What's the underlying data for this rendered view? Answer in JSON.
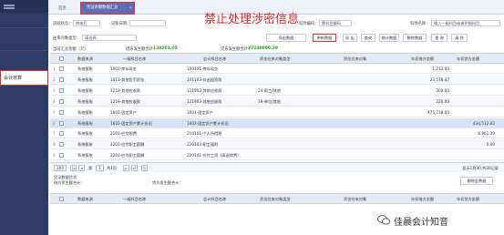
{
  "tabs": [
    {
      "label": "首页"
    },
    {
      "label": "凭证余额数据汇总"
    }
  ],
  "watermark_text": "禁止处理涉密信息",
  "sidebar": {
    "active_item": "会计核算"
  },
  "filters": {
    "row1": [
      {
        "label": "流程状态：",
        "value": "审核后"
      },
      {
        "label": "记账日期：",
        "value": ""
      },
      {
        "label": "科目编码：",
        "value": "需科目编码"
      },
      {
        "label": "科目名称：",
        "value": "输入一级科目或者明细科目"
      }
    ],
    "row2": [
      {
        "label": "往来对象类型：",
        "value": "请选择"
      }
    ]
  },
  "buttons": [
    "导出数据",
    "更新数据",
    "导 出",
    "查询",
    "统计数据",
    "删除数据",
    "查 询",
    "清 除"
  ],
  "summary": {
    "debit_label": "借方发生额合计：",
    "debit_value": "138201.05",
    "credit_label": "贷方发生额合计：",
    "credit_value": "27249990.39",
    "left_label": "当前汇总金额（元）"
  },
  "table": {
    "columns": [
      "数据来源",
      "一级科目名称",
      "会计科目名称",
      "资金往来对象类型",
      "资金往来对象",
      "年初借方金额",
      "年初贷方金额"
    ],
    "rows": [
      {
        "source": "系统报账",
        "l1": "1001-库存现金",
        "acct": "100101-库存现金",
        "ptype": "",
        "party": "",
        "debit": "1,213.00",
        "credit": ""
      },
      {
        "source": "系统报账",
        "l1": "1011-其他货币资金",
        "acct": "101103-存出投资款",
        "ptype": "",
        "party": "",
        "debit": "23,578.47",
        "credit": ""
      },
      {
        "source": "系统报账",
        "l1": "1219-其他应收款",
        "acct": "121903-其他应收款",
        "ptype": "24-职工/其他",
        "party": "",
        "debit": "300.00",
        "credit": ""
      },
      {
        "source": "系统报账",
        "l1": "1219-其他应收款",
        "acct": "121903-其他应收款",
        "ptype": "19-单位/其他",
        "party": "",
        "debit": "220.00",
        "credit": ""
      },
      {
        "source": "系统报账",
        "l1": "1601-固定资产",
        "acct": "1601-固定资产",
        "ptype": "",
        "party": "",
        "debit": "475,738.00",
        "credit": ""
      },
      {
        "source": "系统报账",
        "l1": "1602-固定资产累计折旧",
        "acct": "1602-固定资产累计折旧",
        "ptype": "",
        "party": "",
        "debit": "",
        "credit": "434,512.82"
      },
      {
        "source": "系统报账",
        "l1": "2101-应交税费",
        "acct": "210101-个人所得税",
        "ptype": "",
        "party": "",
        "debit": "",
        "credit": "8,961.39"
      },
      {
        "source": "系统报账",
        "l1": "2201-应付职工薪酬",
        "acct": "220103-职工福利",
        "ptype": "",
        "party": "",
        "debit": "",
        "credit": "0.00"
      },
      {
        "source": "系统报账",
        "l1": "2201-应付职工薪酬",
        "acct": "220101-应付工资（离退休费）",
        "ptype": "",
        "party": "",
        "debit": "",
        "credit": ""
      }
    ]
  },
  "pager": {
    "page_size": "100",
    "page_label": "第",
    "page_num": "1",
    "total_label": "共1页",
    "right_text": "显示1到30,共30记录"
  },
  "lower": {
    "title": "凭证数据信息",
    "debit_label": "借方发生额合计：",
    "credit_label": "贷方发生额合计：",
    "button": "删除此数据",
    "columns": [
      "数据来源",
      "一级科目名称",
      "会计科目名称",
      "资金往来对象类型",
      "资金往来对象",
      "年初借方金额",
      "年初贷方金额"
    ]
  },
  "footer_watermark": "佳晨会计知音",
  "colors": {
    "sidebar": "#2e3b64",
    "tab_active": "#5c6fb3",
    "highlight": "#e03030",
    "summary_value": "#2a9a2a"
  }
}
